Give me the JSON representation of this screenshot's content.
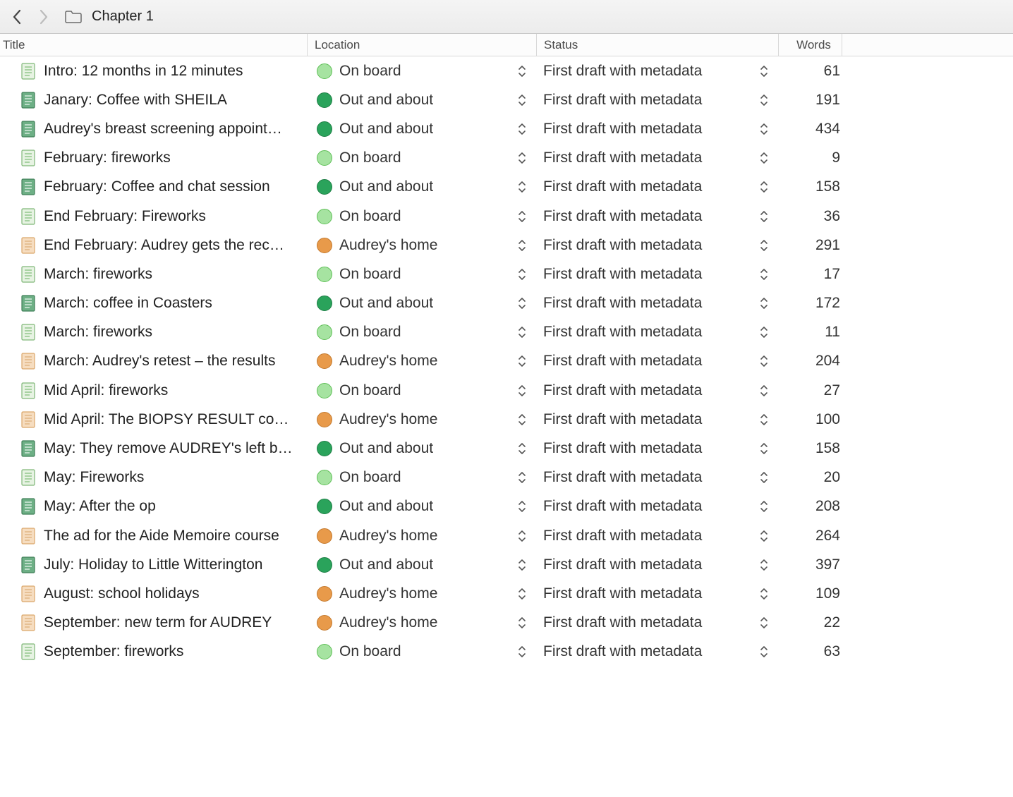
{
  "breadcrumb": {
    "title": "Chapter 1"
  },
  "columns": {
    "title": "Title",
    "location": "Location",
    "status": "Status",
    "words": "Words"
  },
  "colors": {
    "doc_light_green": {
      "fill": "#e7f3e3",
      "stroke": "#7fb777",
      "lines": "#8ec486"
    },
    "doc_dark_green": {
      "fill": "#6daf85",
      "stroke": "#3f7f58",
      "lines": "#dff0e5"
    },
    "doc_orange": {
      "fill": "#f6ddc0",
      "stroke": "#dba76a",
      "lines": "#e0b380"
    },
    "dot_light_green": {
      "fill": "#a6e3a1",
      "stroke": "#5fbf57"
    },
    "dot_dark_green": {
      "fill": "#2aa35b",
      "stroke": "#1f7f46"
    },
    "dot_orange": {
      "fill": "#e89a4a",
      "stroke": "#c47a2e"
    }
  },
  "locations": {
    "on_board": "On board",
    "out_and_about": "Out and about",
    "audreys_home": "Audrey's home"
  },
  "status_default": "First draft with metadata",
  "rows": [
    {
      "title": "Intro: 12 months in 12 minutes",
      "doc": "doc_light_green",
      "loc_key": "on_board",
      "dot": "dot_light_green",
      "words": 61
    },
    {
      "title": "Janary: Coffee with SHEILA",
      "doc": "doc_dark_green",
      "loc_key": "out_and_about",
      "dot": "dot_dark_green",
      "words": 191
    },
    {
      "title": "Audrey's breast screening appoint…",
      "doc": "doc_dark_green",
      "loc_key": "out_and_about",
      "dot": "dot_dark_green",
      "words": 434
    },
    {
      "title": "February: fireworks",
      "doc": "doc_light_green",
      "loc_key": "on_board",
      "dot": "dot_light_green",
      "words": 9
    },
    {
      "title": "February: Coffee and chat session",
      "doc": "doc_dark_green",
      "loc_key": "out_and_about",
      "dot": "dot_dark_green",
      "words": 158
    },
    {
      "title": "End February: Fireworks",
      "doc": "doc_light_green",
      "loc_key": "on_board",
      "dot": "dot_light_green",
      "words": 36
    },
    {
      "title": "End February: Audrey gets the rec…",
      "doc": "doc_orange",
      "loc_key": "audreys_home",
      "dot": "dot_orange",
      "words": 291
    },
    {
      "title": "March: fireworks",
      "doc": "doc_light_green",
      "loc_key": "on_board",
      "dot": "dot_light_green",
      "words": 17
    },
    {
      "title": "March: coffee in Coasters",
      "doc": "doc_dark_green",
      "loc_key": "out_and_about",
      "dot": "dot_dark_green",
      "words": 172
    },
    {
      "title": "March: fireworks",
      "doc": "doc_light_green",
      "loc_key": "on_board",
      "dot": "dot_light_green",
      "words": 11
    },
    {
      "title": "March: Audrey's retest – the results",
      "doc": "doc_orange",
      "loc_key": "audreys_home",
      "dot": "dot_orange",
      "words": 204
    },
    {
      "title": "Mid April: fireworks",
      "doc": "doc_light_green",
      "loc_key": "on_board",
      "dot": "dot_light_green",
      "words": 27
    },
    {
      "title": "Mid April: The BIOPSY RESULT co…",
      "doc": "doc_orange",
      "loc_key": "audreys_home",
      "dot": "dot_orange",
      "words": 100
    },
    {
      "title": "May: They remove AUDREY's left b…",
      "doc": "doc_dark_green",
      "loc_key": "out_and_about",
      "dot": "dot_dark_green",
      "words": 158
    },
    {
      "title": "May: Fireworks",
      "doc": "doc_light_green",
      "loc_key": "on_board",
      "dot": "dot_light_green",
      "words": 20
    },
    {
      "title": "May: After the op",
      "doc": "doc_dark_green",
      "loc_key": "out_and_about",
      "dot": "dot_dark_green",
      "words": 208
    },
    {
      "title": "The ad for the Aide Memoire course",
      "doc": "doc_orange",
      "loc_key": "audreys_home",
      "dot": "dot_orange",
      "words": 264
    },
    {
      "title": "July: Holiday to Little Witterington",
      "doc": "doc_dark_green",
      "loc_key": "out_and_about",
      "dot": "dot_dark_green",
      "words": 397
    },
    {
      "title": "August: school holidays",
      "doc": "doc_orange",
      "loc_key": "audreys_home",
      "dot": "dot_orange",
      "words": 109
    },
    {
      "title": "September: new term for AUDREY",
      "doc": "doc_orange",
      "loc_key": "audreys_home",
      "dot": "dot_orange",
      "words": 22
    },
    {
      "title": "September: fireworks",
      "doc": "doc_light_green",
      "loc_key": "on_board",
      "dot": "dot_light_green",
      "words": 63
    }
  ]
}
